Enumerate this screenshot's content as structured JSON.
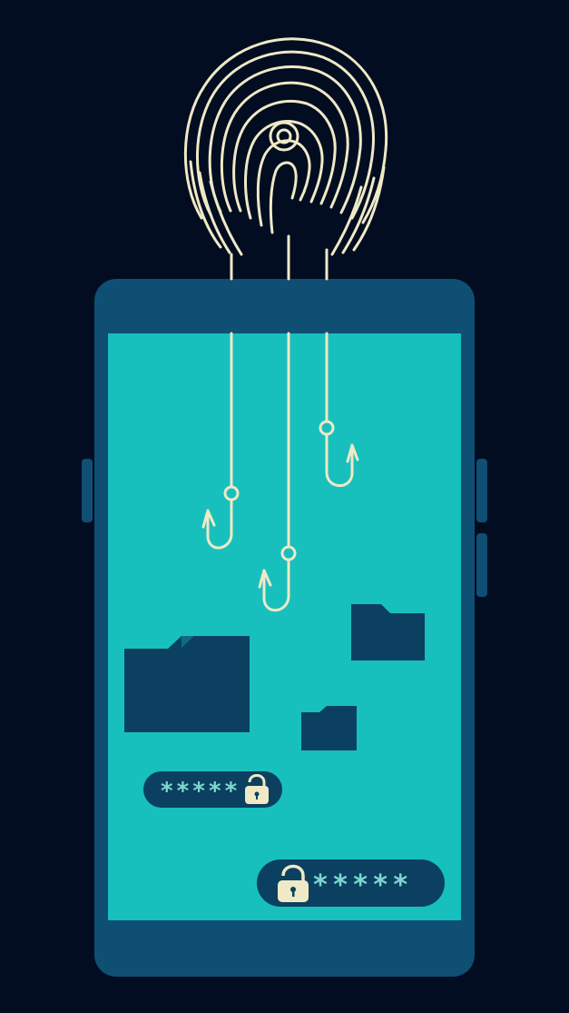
{
  "colors": {
    "background": "#030d22",
    "phone_body": "#0f4f73",
    "phone_button": "#0f4f73",
    "screen": "#17c0bd",
    "fingerprint_line": "#efe9c6",
    "folder": "#0b4060",
    "pill_bg": "#0b4060",
    "pill_text": "#7fd6d0",
    "lock": "#efe9c6"
  },
  "icons": {
    "fingerprint": "fingerprint-icon",
    "hook": "fishhook-icon",
    "folder": "folder-icon",
    "lock": "padlock-icon"
  },
  "password_fields": [
    {
      "mask": "*****",
      "lock_position": "after"
    },
    {
      "mask": "*****",
      "lock_position": "before"
    }
  ]
}
